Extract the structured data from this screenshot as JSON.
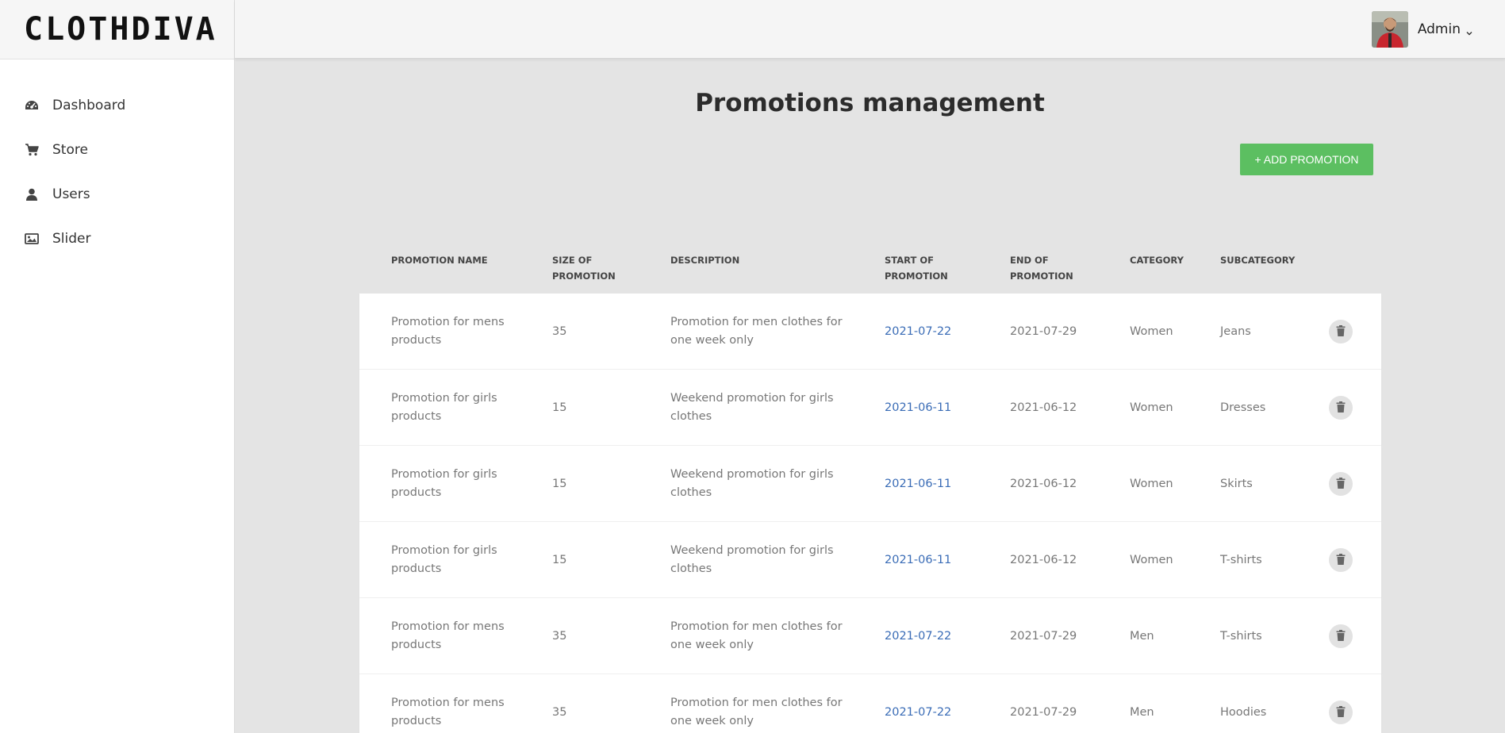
{
  "brand": {
    "name": "CLOTHDIVA"
  },
  "sidebar": {
    "items": [
      {
        "label": "Dashboard",
        "icon": "dashboard-icon"
      },
      {
        "label": "Store",
        "icon": "cart-icon"
      },
      {
        "label": "Users",
        "icon": "user-icon"
      },
      {
        "label": "Slider",
        "icon": "image-icon"
      }
    ]
  },
  "topbar": {
    "user_name": "Admin",
    "avatar": "avatar-photo",
    "caret_icon": "chevron-down-icon"
  },
  "main": {
    "title": "Promotions management",
    "add_button_label": "+ ADD PROMOTION"
  },
  "table": {
    "headers": {
      "name": "PROMOTION NAME",
      "size_line1": "SIZE OF",
      "size_line2": "PROMOTION",
      "description": "DESCRIPTION",
      "start_line1": "START OF",
      "start_line2": "PROMOTION",
      "end_line1": "END OF",
      "end_line2": "PROMOTION",
      "category": "CATEGORY",
      "subcategory": "SUBCATEGORY"
    },
    "rows": [
      {
        "name": "Promotion for mens products",
        "size": "35",
        "description": "Promotion for men clothes for one week only",
        "start": "2021-07-22",
        "end": "2021-07-29",
        "category": "Women",
        "subcategory": "Jeans"
      },
      {
        "name": "Promotion for girls products",
        "size": "15",
        "description": "Weekend promotion for girls clothes",
        "start": "2021-06-11",
        "end": "2021-06-12",
        "category": "Women",
        "subcategory": "Dresses"
      },
      {
        "name": "Promotion for girls products",
        "size": "15",
        "description": "Weekend promotion for girls clothes",
        "start": "2021-06-11",
        "end": "2021-06-12",
        "category": "Women",
        "subcategory": "Skirts"
      },
      {
        "name": "Promotion for girls products",
        "size": "15",
        "description": "Weekend promotion for girls clothes",
        "start": "2021-06-11",
        "end": "2021-06-12",
        "category": "Women",
        "subcategory": "T-shirts"
      },
      {
        "name": "Promotion for mens products",
        "size": "35",
        "description": "Promotion for men clothes for one week only",
        "start": "2021-07-22",
        "end": "2021-07-29",
        "category": "Men",
        "subcategory": "T-shirts"
      },
      {
        "name": "Promotion for mens products",
        "size": "35",
        "description": "Promotion for men clothes for one week only",
        "start": "2021-07-22",
        "end": "2021-07-29",
        "category": "Men",
        "subcategory": "Hoodies"
      }
    ]
  },
  "colors": {
    "accent_green": "#5cbf61",
    "link_blue": "#3a6cb6",
    "background": "#e4e4e4"
  }
}
